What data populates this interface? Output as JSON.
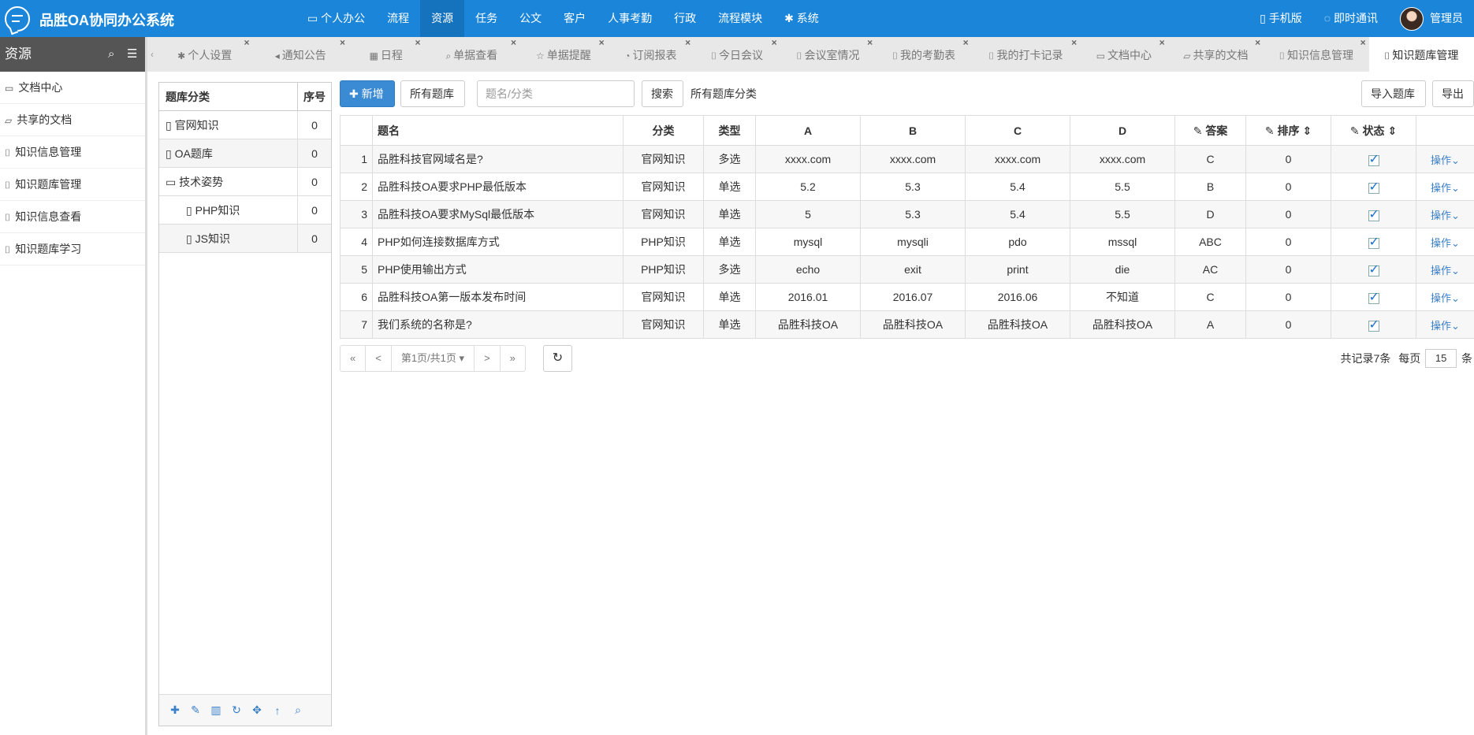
{
  "app": {
    "title": "品胜OA协同办公系统"
  },
  "nav": {
    "items": [
      {
        "label": "个人办公",
        "icon": "monitor-icon"
      },
      {
        "label": "流程"
      },
      {
        "label": "资源"
      },
      {
        "label": "任务"
      },
      {
        "label": "公文"
      },
      {
        "label": "客户"
      },
      {
        "label": "人事考勤"
      },
      {
        "label": "行政"
      },
      {
        "label": "流程模块"
      },
      {
        "label": "系统",
        "icon": "gear-icon"
      }
    ],
    "active": "资源",
    "mobile": "手机版",
    "im": "即时通讯",
    "user": "管理员"
  },
  "sidebar": {
    "title": "资源",
    "items": [
      {
        "label": "文档中心",
        "icon": "folder-icon"
      },
      {
        "label": "共享的文档",
        "icon": "folder-open-icon"
      },
      {
        "label": "知识信息管理",
        "icon": "bookmark-icon"
      },
      {
        "label": "知识题库管理",
        "icon": "bookmark-icon"
      },
      {
        "label": "知识信息查看",
        "icon": "bookmark-icon"
      },
      {
        "label": "知识题库学习",
        "icon": "bookmark-icon"
      }
    ]
  },
  "tabs": [
    {
      "label": "个人设置",
      "icon": "gear-icon"
    },
    {
      "label": "通知公告",
      "icon": "speaker-icon"
    },
    {
      "label": "日程",
      "icon": "calendar-icon"
    },
    {
      "label": "单据查看",
      "icon": "search-icon"
    },
    {
      "label": "单据提醒",
      "icon": "star-icon"
    },
    {
      "label": "订阅报表",
      "icon": "rss-icon"
    },
    {
      "label": "今日会议",
      "icon": "bookmark-icon"
    },
    {
      "label": "会议室情况",
      "icon": "bookmark-icon"
    },
    {
      "label": "我的考勤表",
      "icon": "bookmark-icon"
    },
    {
      "label": "我的打卡记录",
      "icon": "bookmark-icon"
    },
    {
      "label": "文档中心",
      "icon": "folder-icon"
    },
    {
      "label": "共享的文档",
      "icon": "folder-open-icon"
    },
    {
      "label": "知识信息管理",
      "icon": "bookmark-icon"
    },
    {
      "label": "知识题库管理",
      "icon": "bookmark-icon"
    }
  ],
  "categories": {
    "header_name": "题库分类",
    "header_sort": "序号",
    "rows": [
      {
        "name": "官网知识",
        "sort": "0",
        "icon": "file-icon"
      },
      {
        "name": "OA题库",
        "sort": "0",
        "icon": "file-icon"
      },
      {
        "name": "技术姿势",
        "sort": "0",
        "icon": "folder-icon"
      },
      {
        "name": "PHP知识",
        "sort": "0",
        "icon": "file-icon"
      },
      {
        "name": "JS知识",
        "sort": "0",
        "icon": "file-icon"
      }
    ],
    "tools": [
      "add-icon",
      "edit-icon",
      "delete-icon",
      "refresh-icon",
      "move-icon",
      "up-arrow-icon",
      "search-icon"
    ]
  },
  "toolbar": {
    "add": "新增",
    "all_banks": "所有题库",
    "search_placeholder": "题名/分类",
    "search": "搜索",
    "filter_label": "所有题库分类",
    "import": "导入题库",
    "export": "导出"
  },
  "table": {
    "columns": [
      "题名",
      "分类",
      "类型",
      "A",
      "B",
      "C",
      "D",
      "答案",
      "排序",
      "状态"
    ],
    "op_label": "操作",
    "rows": [
      [
        "1",
        "品胜科技官网域名是?",
        "官网知识",
        "多选",
        "xxxx.com",
        "xxxx.com",
        "xxxx.com",
        "xxxx.com",
        "C",
        "0"
      ],
      [
        "2",
        "品胜科技OA要求PHP最低版本",
        "官网知识",
        "单选",
        "5.2",
        "5.3",
        "5.4",
        "5.5",
        "B",
        "0"
      ],
      [
        "3",
        "品胜科技OA要求MySql最低版本",
        "官网知识",
        "单选",
        "5",
        "5.3",
        "5.4",
        "5.5",
        "D",
        "0"
      ],
      [
        "4",
        "PHP如何连接数据库方式",
        "PHP知识",
        "单选",
        "mysql",
        "mysqli",
        "pdo",
        "mssql",
        "ABC",
        "0"
      ],
      [
        "5",
        "PHP使用输出方式",
        "PHP知识",
        "多选",
        "echo",
        "exit",
        "print",
        "die",
        "AC",
        "0"
      ],
      [
        "6",
        "品胜科技OA第一版本发布时间",
        "官网知识",
        "单选",
        "2016.01",
        "2016.07",
        "2016.06",
        "不知道",
        "C",
        "0"
      ],
      [
        "7",
        "我们系统的名称是?",
        "官网知识",
        "单选",
        "品胜科技OA",
        "品胜科技OA",
        "品胜科技OA",
        "品胜科技OA",
        "A",
        "0"
      ]
    ]
  },
  "pager": {
    "first": "«",
    "prev": "<",
    "page_info": "第1页/共1页",
    "next": ">",
    "last": "»",
    "total": "共记录7条",
    "per_page_label": "每页",
    "per_page": "15",
    "unit": "条"
  }
}
